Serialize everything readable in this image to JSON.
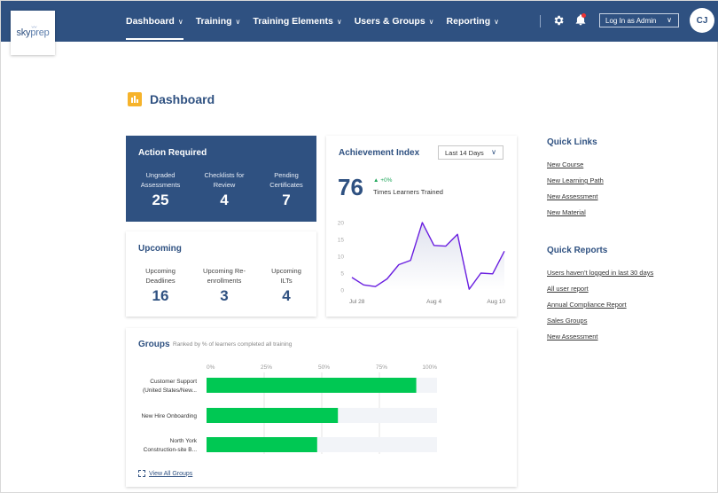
{
  "brand": {
    "logo_main": "sky",
    "logo_accent": "prep"
  },
  "nav": {
    "items": [
      {
        "label": "Dashboard",
        "active": true
      },
      {
        "label": "Training",
        "active": false
      },
      {
        "label": "Training Elements",
        "active": false
      },
      {
        "label": "Users & Groups",
        "active": false
      },
      {
        "label": "Reporting",
        "active": false
      }
    ],
    "login_as": "Log In as Admin",
    "avatar_initials": "CJ",
    "icons": {
      "settings": "gear-icon",
      "notifications": "bell-icon"
    }
  },
  "page": {
    "title": "Dashboard",
    "icon": "bar-chart-icon"
  },
  "action_required": {
    "title": "Action Required",
    "stats": [
      {
        "label": "Ungraded Assessments",
        "value": "25"
      },
      {
        "label": "Checklists for Review",
        "value": "4"
      },
      {
        "label": "Pending Certificates",
        "value": "7"
      }
    ]
  },
  "upcoming": {
    "title": "Upcoming",
    "stats": [
      {
        "label": "Upcoming Deadlines",
        "value": "16"
      },
      {
        "label": "Upcoming Re-enrollments",
        "value": "3"
      },
      {
        "label": "Upcoming ILTs",
        "value": "4"
      }
    ]
  },
  "achievement": {
    "title": "Achievement Index",
    "range": "Last 14 Days",
    "value": "76",
    "delta": "+0%",
    "value_label": "Times Learners Trained"
  },
  "groups": {
    "title": "Groups",
    "subtitle": "Ranked by % of learners completed all training",
    "view_all": "View All Groups"
  },
  "quick_links": {
    "title": "Quick Links",
    "items": [
      "New Course",
      "New Learning Path",
      "New Assessment",
      "New Material"
    ]
  },
  "quick_reports": {
    "title": "Quick Reports",
    "items": [
      "Users haven't logged in last 30 days",
      "All user report",
      "Annual Compliance Report",
      "Sales Groups",
      "New Assessment"
    ]
  },
  "colors": {
    "brand": "#2f5181",
    "accent": "#f6b32b",
    "line": "#6a1fe0",
    "bar": "#00c853",
    "bar_track": "#f2f4f8",
    "positive": "#1fa65a"
  },
  "chart_data": [
    {
      "type": "line",
      "title": "Achievement Index",
      "x": [
        "Jul 28",
        "Jul 29",
        "Jul 30",
        "Jul 31",
        "Aug 1",
        "Aug 2",
        "Aug 3",
        "Aug 4",
        "Aug 5",
        "Aug 6",
        "Aug 7",
        "Aug 8",
        "Aug 9",
        "Aug 10"
      ],
      "values": [
        3.7,
        1.5,
        1.0,
        3.3,
        7.5,
        8.8,
        20,
        13.2,
        13,
        16.5,
        0.2,
        5,
        4.8,
        11.5
      ],
      "xticks": [
        "Jul 28",
        "Aug 4",
        "Aug 10"
      ],
      "yticks": [
        0,
        5,
        10,
        15,
        20
      ],
      "ylim": [
        0,
        20
      ],
      "grid": false,
      "xlabel": "",
      "ylabel": ""
    },
    {
      "type": "bar",
      "orientation": "horizontal",
      "title": "Groups",
      "categories": [
        "Customer Support (United States/New...",
        "New Hire Onboarding",
        "North York Construction-site B..."
      ],
      "category_lines": [
        [
          "Customer Support",
          "(United States/New..."
        ],
        [
          "New Hire Onboarding"
        ],
        [
          "North York",
          "Construction-site B..."
        ]
      ],
      "values": [
        91,
        57,
        48
      ],
      "xticks": [
        "0%",
        "25%",
        "50%",
        "75%",
        "100%"
      ],
      "xlim": [
        0,
        100
      ],
      "grid": true,
      "xlabel": "",
      "ylabel": ""
    }
  ]
}
